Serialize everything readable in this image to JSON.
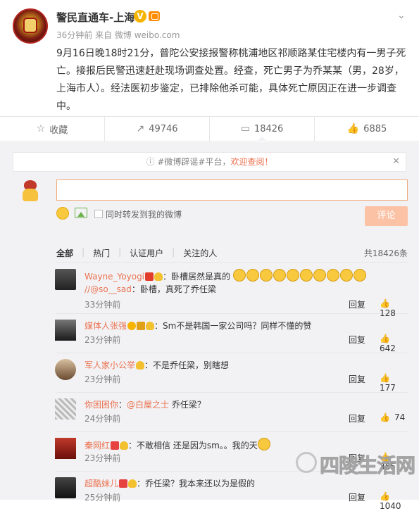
{
  "post": {
    "author": "警民直通车-上海",
    "meta": "36分钟前 来自 微博 weibo.com",
    "text": "9月16日晚18时21分，普陀公安接报警称桃浦地区祁顺路某住宅楼内有一男子死亡。接报后民警迅速赶赴现场调查处置。经查，死亡男子为乔某某（男，28岁，上海市人）。经法医初步鉴定，已排除他杀可能，具体死亡原因正在进一步调查中。"
  },
  "actions": [
    {
      "icon": "star-icon",
      "label": "收藏"
    },
    {
      "icon": "share-icon",
      "label": "49746"
    },
    {
      "icon": "comment-icon",
      "label": "18426"
    },
    {
      "icon": "thumb-up-icon",
      "label": "6885"
    }
  ],
  "notice": {
    "prefix": "#微博辟谣#平台，",
    "highlight": "欢迎查阅！"
  },
  "composer": {
    "repost_label": "同时转发到我的微博",
    "submit_label": "评论"
  },
  "filters": {
    "tabs": [
      "全部",
      "热门",
      "认证用户",
      "关注的人"
    ],
    "total": "共18426条"
  },
  "comments": [
    {
      "user": "Wayne_Yoyogi",
      "text": "：卧槽居然是真的",
      "line2_mention": "//@so__sad",
      "line2_text": "：卧槽，真死了乔任梁",
      "time": "33分钟前",
      "reply": "回复",
      "likes": "128"
    },
    {
      "user": "媒体人张强",
      "text": "：Sm不是韩国一家公司吗？同样不懂的赞",
      "time": "23分钟前",
      "reply": "回复",
      "likes": "642"
    },
    {
      "user": "军人家小公举",
      "text": "：不是乔任梁，别瞎想",
      "time": "23分钟前",
      "reply": "回复",
      "likes": "177"
    },
    {
      "user": "你困困你",
      "mention": "@白屋之士",
      "text": " 乔任梁？",
      "time": "24分钟前",
      "reply": "回复",
      "likes": "74"
    },
    {
      "user": "秦网红",
      "text": "：不敢相信 还是因为sm。。我的天",
      "time": "23分钟前",
      "reply": "回复",
      "likes": "365"
    },
    {
      "user": "超酷妹儿",
      "text": "：乔任梁？我本来还以为是假的",
      "time": "25分钟前",
      "reply": "回复",
      "likes": "1040"
    }
  ],
  "watermark": "四陵生活网",
  "colors": {
    "accent": "#eb7350",
    "verified": "#f6b400",
    "submit": "#fcc2a6"
  }
}
